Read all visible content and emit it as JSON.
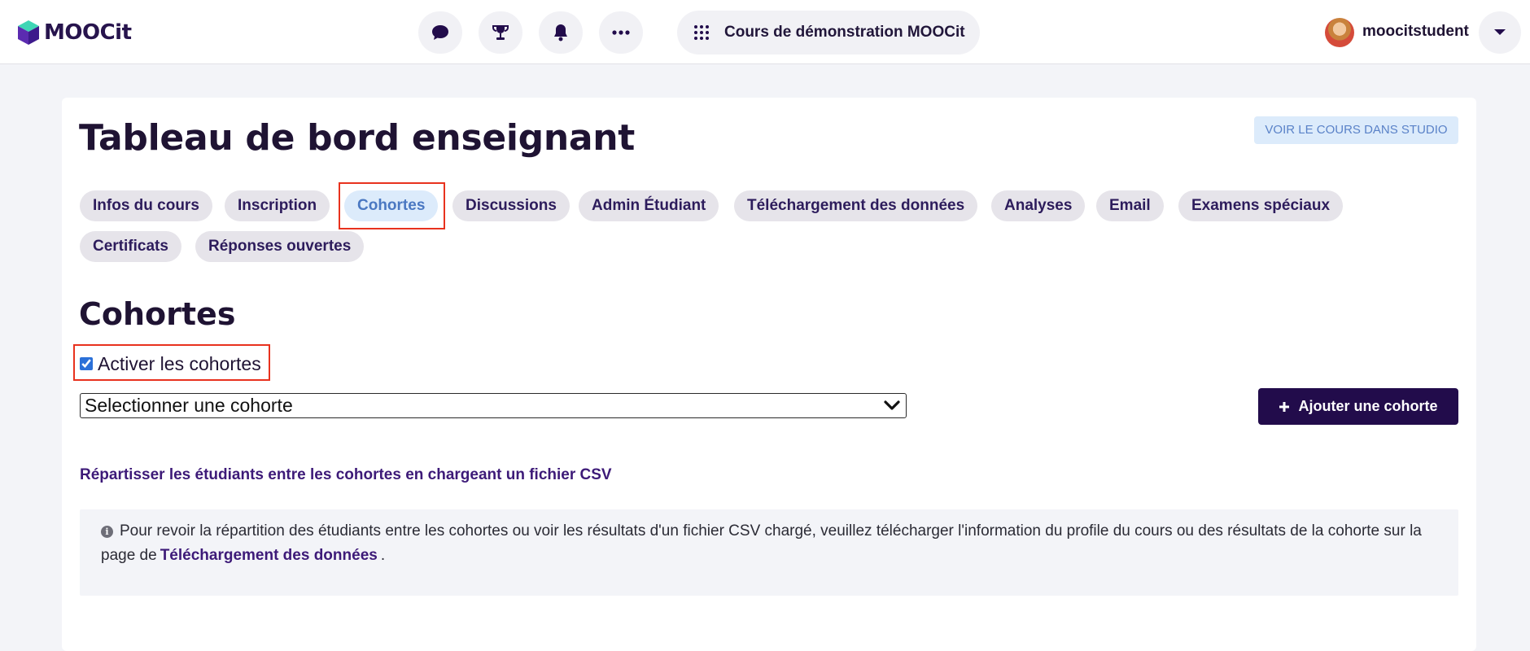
{
  "header": {
    "logo_text": "MOOCit",
    "icons": [
      "chat-icon",
      "trophy-icon",
      "bell-icon",
      "more-icon"
    ],
    "course_title": "Cours de démonstration MOOCit",
    "username": "moocitstudent"
  },
  "dashboard": {
    "title": "Tableau de bord enseignant",
    "studio_button": "VOIR LE COURS DANS STUDIO",
    "tabs": [
      "Infos du cours",
      "Inscription",
      "Cohortes",
      "Discussions",
      "Admin Étudiant",
      "Téléchargement des données",
      "Analyses",
      "Email",
      "Examens spéciaux",
      "Certificats",
      "Réponses ouvertes"
    ],
    "active_tab": "Cohortes"
  },
  "cohorts": {
    "section_title": "Cohortes",
    "enable_label": "Activer les cohortes",
    "enable_checked": true,
    "select_value": "Selectionner une cohorte",
    "add_button": "Ajouter une cohorte",
    "csv_link": "Répartisser les étudiants entre les cohortes en chargeant un fichier CSV",
    "info_text": "Pour revoir la répartition des étudiants entre les cohortes ou voir les résultats d'un fichier CSV chargé, veuillez télécharger l'information du profile du cours ou des résultats de la cohorte sur la page de",
    "info_link": "Téléchargement des données",
    "info_end": "."
  },
  "colors": {
    "brand": "#220c4b",
    "accent_blue": "#4a78c2",
    "highlight": "#e8321e"
  }
}
